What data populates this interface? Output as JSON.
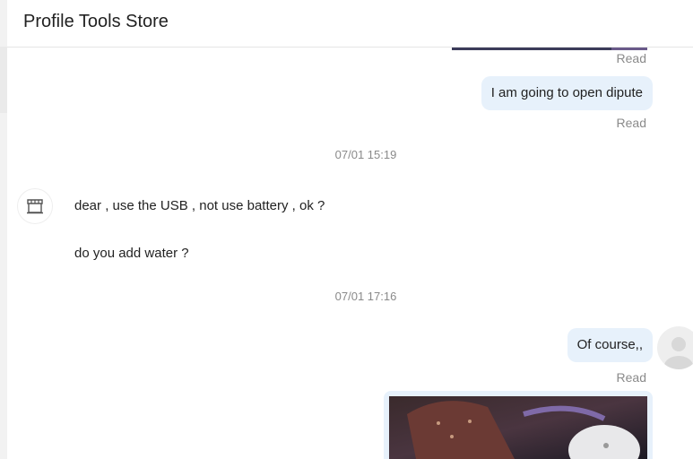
{
  "header": {
    "title": "Profile Tools Store"
  },
  "chat": {
    "messages": [
      {
        "status": "Read"
      },
      {
        "text": "I am going to open dipute",
        "status": "Read"
      },
      {
        "time": "07/01 15:19"
      },
      {
        "text": "dear , use the USB , not use battery , ok ?"
      },
      {
        "text": "do you add water ?"
      },
      {
        "time": "07/01 17:16"
      },
      {
        "text": "Of course,,",
        "status": "Read"
      }
    ]
  },
  "colors": {
    "outgoing_bubble": "#e7f1fb",
    "muted_text": "#8a8a8a",
    "divider": "#e6e6e6"
  },
  "icons": {
    "shop_avatar": "store-icon",
    "user_avatar": "user-silhouette-icon"
  }
}
